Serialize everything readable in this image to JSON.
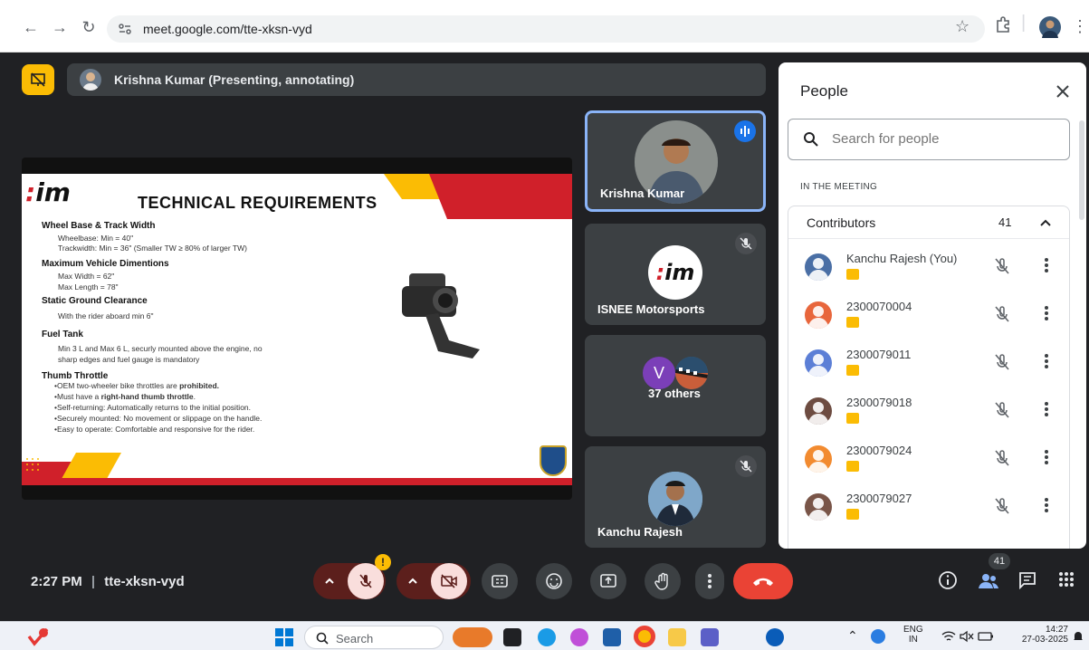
{
  "browser": {
    "url": "meet.google.com/tte-xksn-vyd"
  },
  "meet": {
    "presenter_label": "Krishna Kumar (Presenting, annotating)",
    "time": "2:27 PM",
    "separator": "|",
    "meeting_code": "tte-xksn-vyd",
    "people_count_badge": "41",
    "mic_alert": "!"
  },
  "slide": {
    "logo": "im",
    "title": "TECHNICAL REQUIREMENTS",
    "sections": [
      {
        "heading": "Wheel Base & Track Width",
        "lines": [
          "Wheelbase: Min = 40\"",
          "Trackwidth: Min = 36\" (Smaller TW ≥ 80% of larger TW)"
        ]
      },
      {
        "heading": "Maximum Vehicle Dimentions",
        "lines": [
          "Max Width = 62\"",
          "Max Length =  78\""
        ]
      },
      {
        "heading": "Static Ground Clearance",
        "lines": [
          "With the rider aboard min 6\""
        ]
      },
      {
        "heading": "Fuel Tank",
        "lines": [
          "Min 3 L and Max 6 L, securly mounted above the engine, no",
          "sharp edges and fuel gauge is mandatory"
        ]
      }
    ],
    "throttle_heading": "Thumb Throttle",
    "throttle_bullets": [
      {
        "pre": "OEM two-wheeler bike throttles are ",
        "bold": "prohibited.",
        "post": ""
      },
      {
        "pre": "Must have a ",
        "bold": "right-hand thumb throttle",
        "post": "."
      },
      {
        "pre": "Self-returning: Automatically returns to the initial position.",
        "bold": "",
        "post": ""
      },
      {
        "pre": "Securely mounted: No movement or slippage on the handle.",
        "bold": "",
        "post": ""
      },
      {
        "pre": "Easy to operate: Comfortable and responsive for the rider.",
        "bold": "",
        "post": ""
      }
    ]
  },
  "tiles": [
    {
      "name": "Krishna Kumar"
    },
    {
      "name": "ISNEE Motorsports",
      "logo": "im"
    },
    {
      "name": "37 others",
      "initial": "V"
    },
    {
      "name": "Kanchu Rajesh"
    }
  ],
  "people_panel": {
    "title": "People",
    "search_placeholder": "Search for people",
    "section_label": "IN THE MEETING",
    "group_label": "Contributors",
    "group_count": "41",
    "participants": [
      {
        "name": "Kanchu Rajesh (You)",
        "avatar_color": "#4a6fa5"
      },
      {
        "name": "2300070004",
        "avatar_color": "#e8663c"
      },
      {
        "name": "2300079011",
        "avatar_color": "#5c7fd6"
      },
      {
        "name": "2300079018",
        "avatar_color": "#6d4c41"
      },
      {
        "name": "2300079024",
        "avatar_color": "#f28b30"
      },
      {
        "name": "2300079027",
        "avatar_color": "#795548"
      }
    ]
  },
  "taskbar": {
    "search_label": "Search",
    "lang_top": "ENG",
    "lang_bottom": "IN",
    "clock_time": "14:27",
    "clock_date": "27-03-2025"
  },
  "colors": {
    "meet_red": "#ea4335",
    "present_yellow": "#fbbc04",
    "speaking_blue": "#1a73e8",
    "slide_red": "#d0202a"
  }
}
